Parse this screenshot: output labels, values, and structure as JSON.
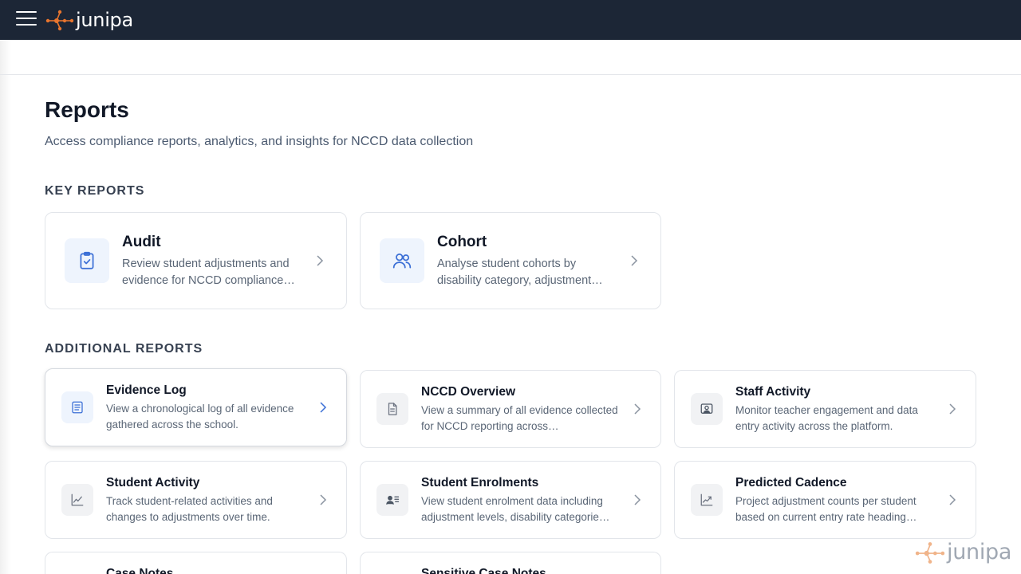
{
  "app": {
    "brand": "junipa",
    "watermark": "junipa",
    "colors": {
      "topbar": "#1c2636",
      "brand_accent": "#e8752e",
      "icon_blue": "#3b6fd6",
      "icon_gray": "#6b7280"
    }
  },
  "header": {
    "menu_icon": "hamburger-menu-icon",
    "logo_icon": "junipa-network-logo-icon"
  },
  "page": {
    "title": "Reports",
    "subtitle": "Access compliance reports, analytics, and insights for NCCD data collection"
  },
  "sections": {
    "key_label": "KEY REPORTS",
    "additional_label": "ADDITIONAL REPORTS"
  },
  "key_reports": [
    {
      "title": "Audit",
      "description": "Review student adjustments and evidence for NCCD compliance…",
      "icon": "clipboard-check-icon"
    },
    {
      "title": "Cohort",
      "description": "Analyse student cohorts by disability category, adjustment…",
      "icon": "users-icon"
    }
  ],
  "additional_reports": [
    {
      "title": "Evidence Log",
      "description": "View a chronological log of all evidence gathered across the school.",
      "icon": "list-document-icon"
    },
    {
      "title": "NCCD Overview",
      "description": "View a summary of all evidence collected for NCCD reporting across…",
      "icon": "document-icon"
    },
    {
      "title": "Staff Activity",
      "description": "Monitor teacher engagement and data entry activity across the platform.",
      "icon": "user-monitor-icon"
    },
    {
      "title": "Student Activity",
      "description": "Track student-related activities and changes to adjustments over time.",
      "icon": "line-chart-icon"
    },
    {
      "title": "Student Enrolments",
      "description": "View student enrolment data including adjustment levels, disability categorie…",
      "icon": "user-list-icon"
    },
    {
      "title": "Predicted Cadence",
      "description": "Project adjustment counts per student based on current entry rate heading…",
      "icon": "trending-up-icon"
    },
    {
      "title": "Case Notes",
      "description": "",
      "icon": ""
    },
    {
      "title": "Sensitive Case Notes",
      "description": "",
      "icon": ""
    }
  ]
}
